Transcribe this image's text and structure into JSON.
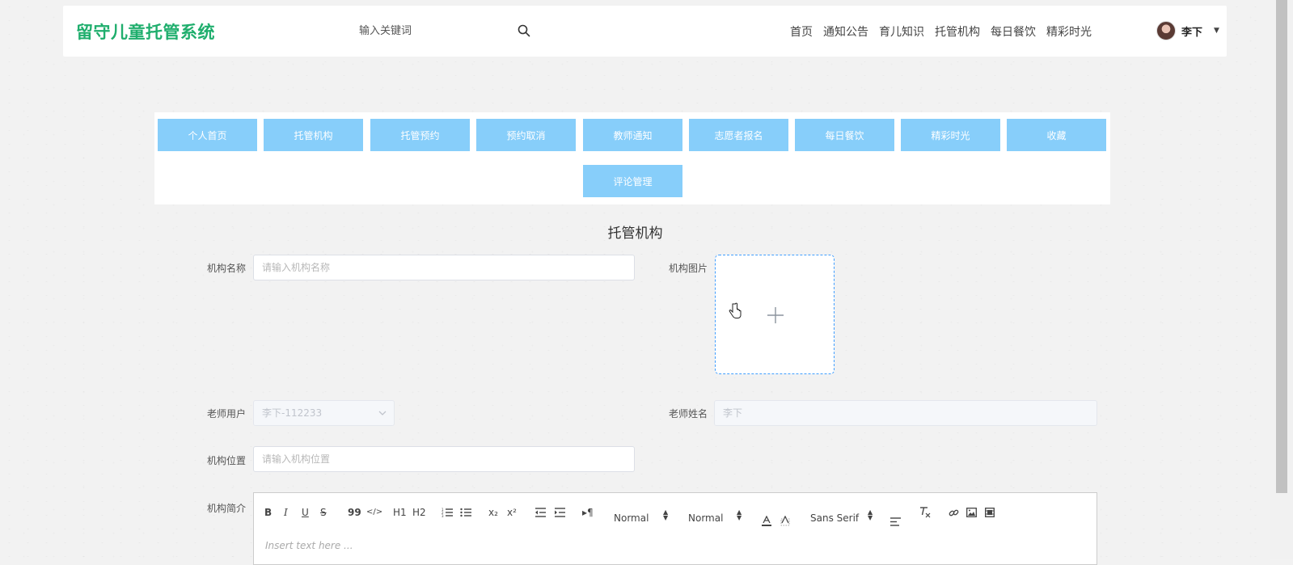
{
  "header": {
    "logo": "留守儿童托管系统",
    "search_placeholder": "输入关键词",
    "nav": [
      "首页",
      "通知公告",
      "育儿知识",
      "托管机构",
      "每日餐饮",
      "精彩时光"
    ],
    "username": "李下"
  },
  "menu": {
    "row1": [
      "个人首页",
      "托管机构",
      "托管预约",
      "预约取消",
      "教师通知",
      "志愿者报名",
      "每日餐饮",
      "精彩时光",
      "收藏"
    ],
    "row2": [
      "评论管理"
    ]
  },
  "form": {
    "title": "托管机构",
    "name_label": "机构名称",
    "name_placeholder": "请输入机构名称",
    "image_label": "机构图片",
    "teacher_user_label": "老师用户",
    "teacher_user_value": "李下-112233",
    "teacher_name_label": "老师姓名",
    "teacher_name_value": "李下",
    "location_label": "机构位置",
    "location_placeholder": "请输入机构位置",
    "intro_label": "机构简介"
  },
  "editor": {
    "toolbar": {
      "bold": "B",
      "italic": "I",
      "underline": "U",
      "strike": "S",
      "blockquote": "99",
      "code": "</>",
      "h1": "H1",
      "h2": "H2",
      "subscript": "x₂",
      "superscript": "x²",
      "direction": "▸¶",
      "size": "Normal",
      "header": "Normal",
      "font": "Sans Serif"
    },
    "placeholder": "Insert text here ..."
  },
  "colors": {
    "logo": "#1fae6d",
    "menu_button": "#87cefa",
    "upload_border": "#409eff"
  }
}
